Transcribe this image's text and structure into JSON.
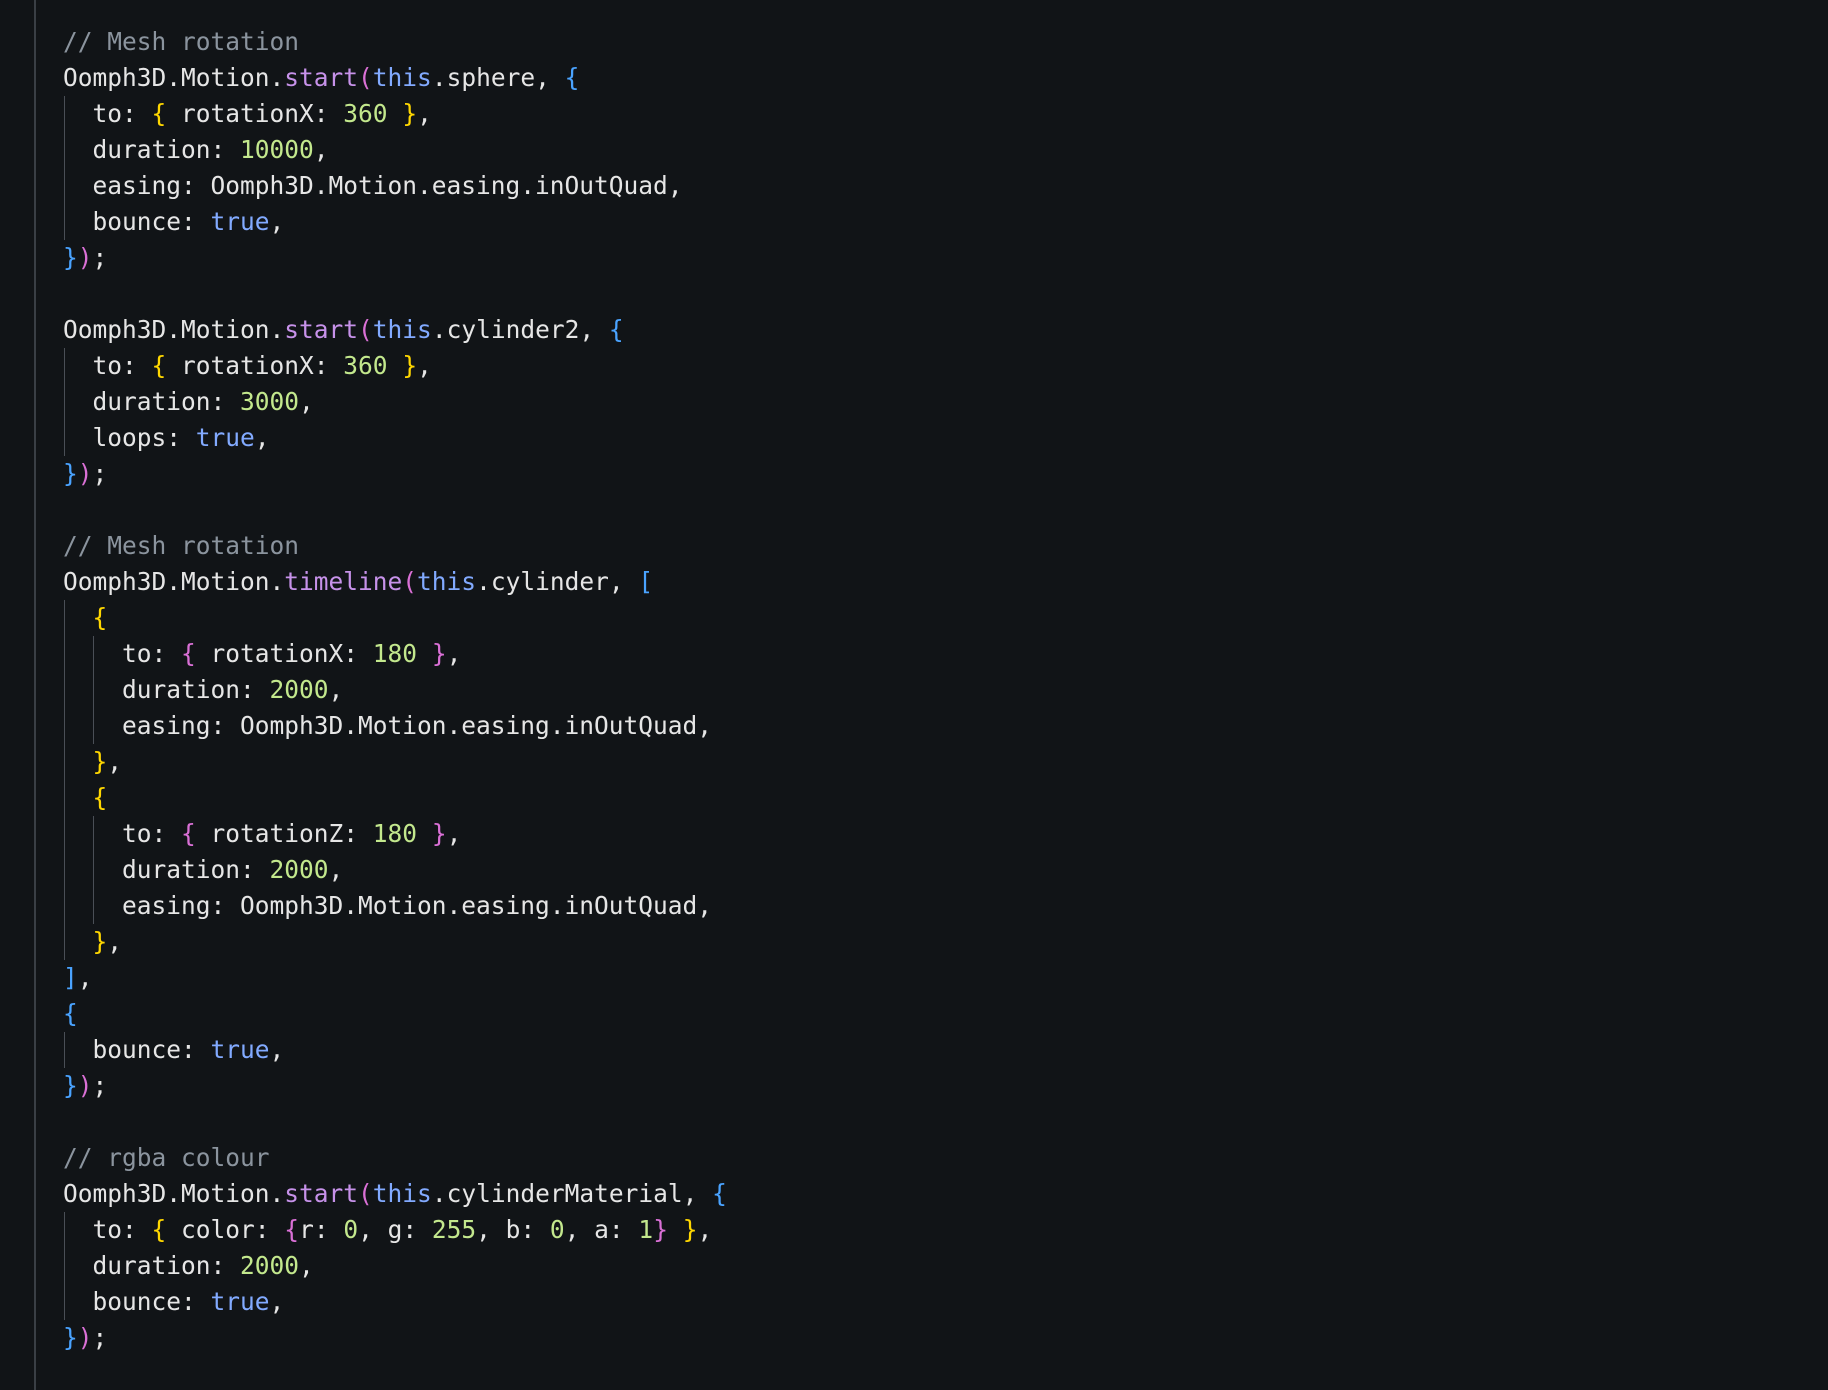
{
  "colors": {
    "background": "#111417",
    "default": "#e6e6e6",
    "comment": "#8b949e",
    "method": "#c792ea",
    "keyword": "#82aaff",
    "number": "#c3e88d",
    "brace_yellow": "#ffd700",
    "brace_blue": "#4aa3ff",
    "brace_magenta": "#da70d6",
    "boolean": "#82aaff",
    "punct": "#e6e6e6"
  },
  "code_lines": [
    {
      "guides": 0,
      "tokens": [
        {
          "t": "// Mesh rotation",
          "c": "comment"
        }
      ]
    },
    {
      "guides": 0,
      "tokens": [
        {
          "t": "Oomph3D.Motion.",
          "c": "default"
        },
        {
          "t": "start",
          "c": "method"
        },
        {
          "t": "(",
          "c": "brace_magenta"
        },
        {
          "t": "this",
          "c": "keyword"
        },
        {
          "t": ".sphere, ",
          "c": "default"
        },
        {
          "t": "{",
          "c": "brace_blue"
        }
      ]
    },
    {
      "guides": 1,
      "tokens": [
        {
          "t": "  to: ",
          "c": "default"
        },
        {
          "t": "{",
          "c": "brace_yellow"
        },
        {
          "t": " rotationX: ",
          "c": "default"
        },
        {
          "t": "360",
          "c": "number"
        },
        {
          "t": " ",
          "c": "default"
        },
        {
          "t": "}",
          "c": "brace_yellow"
        },
        {
          "t": ",",
          "c": "default"
        }
      ]
    },
    {
      "guides": 1,
      "tokens": [
        {
          "t": "  duration: ",
          "c": "default"
        },
        {
          "t": "10000",
          "c": "number"
        },
        {
          "t": ",",
          "c": "default"
        }
      ]
    },
    {
      "guides": 1,
      "tokens": [
        {
          "t": "  easing: Oomph3D.Motion.easing.inOutQuad,",
          "c": "default"
        }
      ]
    },
    {
      "guides": 1,
      "tokens": [
        {
          "t": "  bounce: ",
          "c": "default"
        },
        {
          "t": "true",
          "c": "boolean"
        },
        {
          "t": ",",
          "c": "default"
        }
      ]
    },
    {
      "guides": 0,
      "tokens": [
        {
          "t": "}",
          "c": "brace_blue"
        },
        {
          "t": ")",
          "c": "brace_magenta"
        },
        {
          "t": ";",
          "c": "default"
        }
      ]
    },
    {
      "guides": 0,
      "tokens": [
        {
          "t": "",
          "c": "default"
        }
      ]
    },
    {
      "guides": 0,
      "tokens": [
        {
          "t": "Oomph3D.Motion.",
          "c": "default"
        },
        {
          "t": "start",
          "c": "method"
        },
        {
          "t": "(",
          "c": "brace_magenta"
        },
        {
          "t": "this",
          "c": "keyword"
        },
        {
          "t": ".cylinder2, ",
          "c": "default"
        },
        {
          "t": "{",
          "c": "brace_blue"
        }
      ]
    },
    {
      "guides": 1,
      "tokens": [
        {
          "t": "  to: ",
          "c": "default"
        },
        {
          "t": "{",
          "c": "brace_yellow"
        },
        {
          "t": " rotationX: ",
          "c": "default"
        },
        {
          "t": "360",
          "c": "number"
        },
        {
          "t": " ",
          "c": "default"
        },
        {
          "t": "}",
          "c": "brace_yellow"
        },
        {
          "t": ",",
          "c": "default"
        }
      ]
    },
    {
      "guides": 1,
      "tokens": [
        {
          "t": "  duration: ",
          "c": "default"
        },
        {
          "t": "3000",
          "c": "number"
        },
        {
          "t": ",",
          "c": "default"
        }
      ]
    },
    {
      "guides": 1,
      "tokens": [
        {
          "t": "  loops: ",
          "c": "default"
        },
        {
          "t": "true",
          "c": "boolean"
        },
        {
          "t": ",",
          "c": "default"
        }
      ]
    },
    {
      "guides": 0,
      "tokens": [
        {
          "t": "}",
          "c": "brace_blue"
        },
        {
          "t": ")",
          "c": "brace_magenta"
        },
        {
          "t": ";",
          "c": "default"
        }
      ]
    },
    {
      "guides": 0,
      "tokens": [
        {
          "t": "",
          "c": "default"
        }
      ]
    },
    {
      "guides": 0,
      "tokens": [
        {
          "t": "// Mesh rotation",
          "c": "comment"
        }
      ]
    },
    {
      "guides": 0,
      "tokens": [
        {
          "t": "Oomph3D.Motion.",
          "c": "default"
        },
        {
          "t": "timeline",
          "c": "method"
        },
        {
          "t": "(",
          "c": "brace_magenta"
        },
        {
          "t": "this",
          "c": "keyword"
        },
        {
          "t": ".cylinder, ",
          "c": "default"
        },
        {
          "t": "[",
          "c": "brace_blue"
        }
      ]
    },
    {
      "guides": 1,
      "tokens": [
        {
          "t": "  ",
          "c": "default"
        },
        {
          "t": "{",
          "c": "brace_yellow"
        }
      ]
    },
    {
      "guides": 2,
      "tokens": [
        {
          "t": "    to: ",
          "c": "default"
        },
        {
          "t": "{",
          "c": "brace_magenta"
        },
        {
          "t": " rotationX: ",
          "c": "default"
        },
        {
          "t": "180",
          "c": "number"
        },
        {
          "t": " ",
          "c": "default"
        },
        {
          "t": "}",
          "c": "brace_magenta"
        },
        {
          "t": ",",
          "c": "default"
        }
      ]
    },
    {
      "guides": 2,
      "tokens": [
        {
          "t": "    duration: ",
          "c": "default"
        },
        {
          "t": "2000",
          "c": "number"
        },
        {
          "t": ",",
          "c": "default"
        }
      ]
    },
    {
      "guides": 2,
      "tokens": [
        {
          "t": "    easing: Oomph3D.Motion.easing.inOutQuad,",
          "c": "default"
        }
      ]
    },
    {
      "guides": 1,
      "tokens": [
        {
          "t": "  ",
          "c": "default"
        },
        {
          "t": "}",
          "c": "brace_yellow"
        },
        {
          "t": ",",
          "c": "default"
        }
      ]
    },
    {
      "guides": 1,
      "tokens": [
        {
          "t": "  ",
          "c": "default"
        },
        {
          "t": "{",
          "c": "brace_yellow"
        }
      ]
    },
    {
      "guides": 2,
      "tokens": [
        {
          "t": "    to: ",
          "c": "default"
        },
        {
          "t": "{",
          "c": "brace_magenta"
        },
        {
          "t": " rotationZ: ",
          "c": "default"
        },
        {
          "t": "180",
          "c": "number"
        },
        {
          "t": " ",
          "c": "default"
        },
        {
          "t": "}",
          "c": "brace_magenta"
        },
        {
          "t": ",",
          "c": "default"
        }
      ]
    },
    {
      "guides": 2,
      "tokens": [
        {
          "t": "    duration: ",
          "c": "default"
        },
        {
          "t": "2000",
          "c": "number"
        },
        {
          "t": ",",
          "c": "default"
        }
      ]
    },
    {
      "guides": 2,
      "tokens": [
        {
          "t": "    easing: Oomph3D.Motion.easing.inOutQuad,",
          "c": "default"
        }
      ]
    },
    {
      "guides": 1,
      "tokens": [
        {
          "t": "  ",
          "c": "default"
        },
        {
          "t": "}",
          "c": "brace_yellow"
        },
        {
          "t": ",",
          "c": "default"
        }
      ]
    },
    {
      "guides": 0,
      "tokens": [
        {
          "t": "]",
          "c": "brace_blue"
        },
        {
          "t": ",",
          "c": "default"
        }
      ]
    },
    {
      "guides": 0,
      "tokens": [
        {
          "t": "{",
          "c": "brace_blue"
        }
      ]
    },
    {
      "guides": 1,
      "tokens": [
        {
          "t": "  bounce: ",
          "c": "default"
        },
        {
          "t": "true",
          "c": "boolean"
        },
        {
          "t": ",",
          "c": "default"
        }
      ]
    },
    {
      "guides": 0,
      "tokens": [
        {
          "t": "}",
          "c": "brace_blue"
        },
        {
          "t": ")",
          "c": "brace_magenta"
        },
        {
          "t": ";",
          "c": "default"
        }
      ]
    },
    {
      "guides": 0,
      "tokens": [
        {
          "t": "",
          "c": "default"
        }
      ]
    },
    {
      "guides": 0,
      "tokens": [
        {
          "t": "// rgba colour",
          "c": "comment"
        }
      ]
    },
    {
      "guides": 0,
      "tokens": [
        {
          "t": "Oomph3D.Motion.",
          "c": "default"
        },
        {
          "t": "start",
          "c": "method"
        },
        {
          "t": "(",
          "c": "brace_magenta"
        },
        {
          "t": "this",
          "c": "keyword"
        },
        {
          "t": ".cylinderMaterial, ",
          "c": "default"
        },
        {
          "t": "{",
          "c": "brace_blue"
        }
      ]
    },
    {
      "guides": 1,
      "tokens": [
        {
          "t": "  to: ",
          "c": "default"
        },
        {
          "t": "{",
          "c": "brace_yellow"
        },
        {
          "t": " color: ",
          "c": "default"
        },
        {
          "t": "{",
          "c": "brace_magenta"
        },
        {
          "t": "r: ",
          "c": "default"
        },
        {
          "t": "0",
          "c": "number"
        },
        {
          "t": ", g: ",
          "c": "default"
        },
        {
          "t": "255",
          "c": "number"
        },
        {
          "t": ", b: ",
          "c": "default"
        },
        {
          "t": "0",
          "c": "number"
        },
        {
          "t": ", a: ",
          "c": "default"
        },
        {
          "t": "1",
          "c": "number"
        },
        {
          "t": "}",
          "c": "brace_magenta"
        },
        {
          "t": " ",
          "c": "default"
        },
        {
          "t": "}",
          "c": "brace_yellow"
        },
        {
          "t": ",",
          "c": "default"
        }
      ]
    },
    {
      "guides": 1,
      "tokens": [
        {
          "t": "  duration: ",
          "c": "default"
        },
        {
          "t": "2000",
          "c": "number"
        },
        {
          "t": ",",
          "c": "default"
        }
      ]
    },
    {
      "guides": 1,
      "tokens": [
        {
          "t": "  bounce: ",
          "c": "default"
        },
        {
          "t": "true",
          "c": "boolean"
        },
        {
          "t": ",",
          "c": "default"
        }
      ]
    },
    {
      "guides": 0,
      "tokens": [
        {
          "t": "}",
          "c": "brace_blue"
        },
        {
          "t": ")",
          "c": "brace_magenta"
        },
        {
          "t": ";",
          "c": "default"
        }
      ]
    }
  ]
}
